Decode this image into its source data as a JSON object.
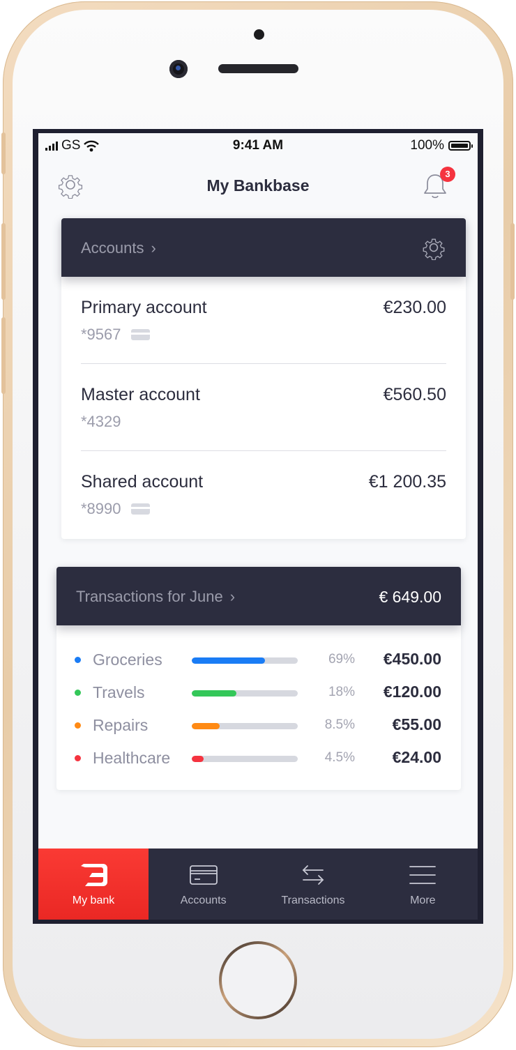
{
  "status_bar": {
    "carrier": "GS",
    "time": "9:41 AM",
    "battery": "100%"
  },
  "header": {
    "title": "My Bankbase",
    "notification_count": "3"
  },
  "accounts_section": {
    "title": "Accounts",
    "accounts": [
      {
        "name": "Primary account",
        "number": "*9567",
        "amount": "€230.00",
        "has_card": true
      },
      {
        "name": "Master account",
        "number": "*4329",
        "amount": "€560.50",
        "has_card": false
      },
      {
        "name": "Shared account",
        "number": "*8990",
        "amount": "€1 200.35",
        "has_card": true
      }
    ]
  },
  "transactions_section": {
    "title": "Transactions for June",
    "total": "€ 649.00",
    "categories": [
      {
        "name": "Groceries",
        "percent": "69%",
        "amount": "€450.00",
        "color": "#1a7cf5",
        "fill": 0.69
      },
      {
        "name": "Travels",
        "percent": "18%",
        "amount": "€120.00",
        "color": "#34c759",
        "fill": 0.42
      },
      {
        "name": "Repairs",
        "percent": "8.5%",
        "amount": "€55.00",
        "color": "#ff8a14",
        "fill": 0.26
      },
      {
        "name": "Healthcare",
        "percent": "4.5%",
        "amount": "€24.00",
        "color": "#f5333f",
        "fill": 0.11
      }
    ]
  },
  "tabbar": {
    "tabs": [
      {
        "label": "My bank",
        "icon": "bank-logo-icon",
        "active": true
      },
      {
        "label": "Accounts",
        "icon": "card-icon",
        "active": false
      },
      {
        "label": "Transactions",
        "icon": "transfer-arrows-icon",
        "active": false
      },
      {
        "label": "More",
        "icon": "menu-icon",
        "active": false
      }
    ]
  },
  "colors": {
    "accent": "#f5333f",
    "dark": "#2c2d3f"
  }
}
